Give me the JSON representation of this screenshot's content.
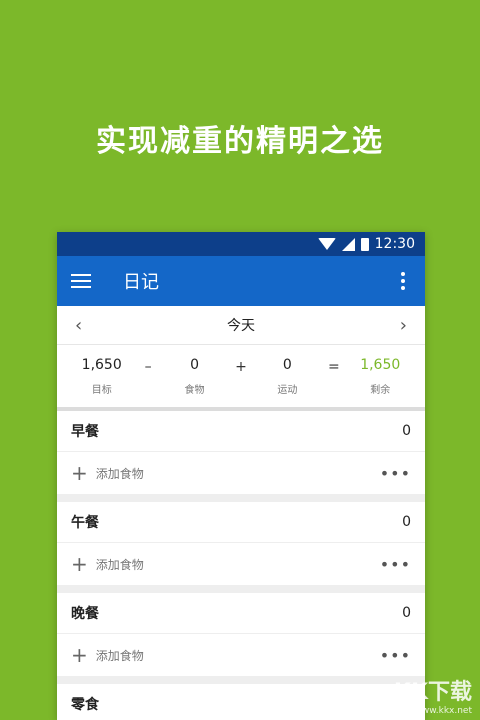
{
  "headline": "实现减重的精明之选",
  "status": {
    "time": "12:30"
  },
  "appbar": {
    "title": "日记"
  },
  "date": {
    "label": "今天"
  },
  "summary": {
    "goal": {
      "value": "1,650",
      "label": "目标"
    },
    "food": {
      "value": "0",
      "label": "食物"
    },
    "exercise": {
      "value": "0",
      "label": "运动"
    },
    "remaining": {
      "value": "1,650",
      "label": "剩余"
    },
    "ops": {
      "minus": "–",
      "plus": "+",
      "equals": "="
    }
  },
  "meals": [
    {
      "name": "早餐",
      "calories": "0",
      "add_label": "添加食物"
    },
    {
      "name": "午餐",
      "calories": "0",
      "add_label": "添加食物"
    },
    {
      "name": "晚餐",
      "calories": "0",
      "add_label": "添加食物"
    },
    {
      "name": "零食"
    }
  ],
  "icons": {
    "plus": "+",
    "more": "•••"
  },
  "watermark": {
    "brand": "KK下载",
    "url": "www.kkx.net"
  },
  "colors": {
    "background": "#7cb82a",
    "appbar": "#1467c8",
    "statusbar": "#0d3f8a",
    "accent_green": "#7cb82a"
  }
}
